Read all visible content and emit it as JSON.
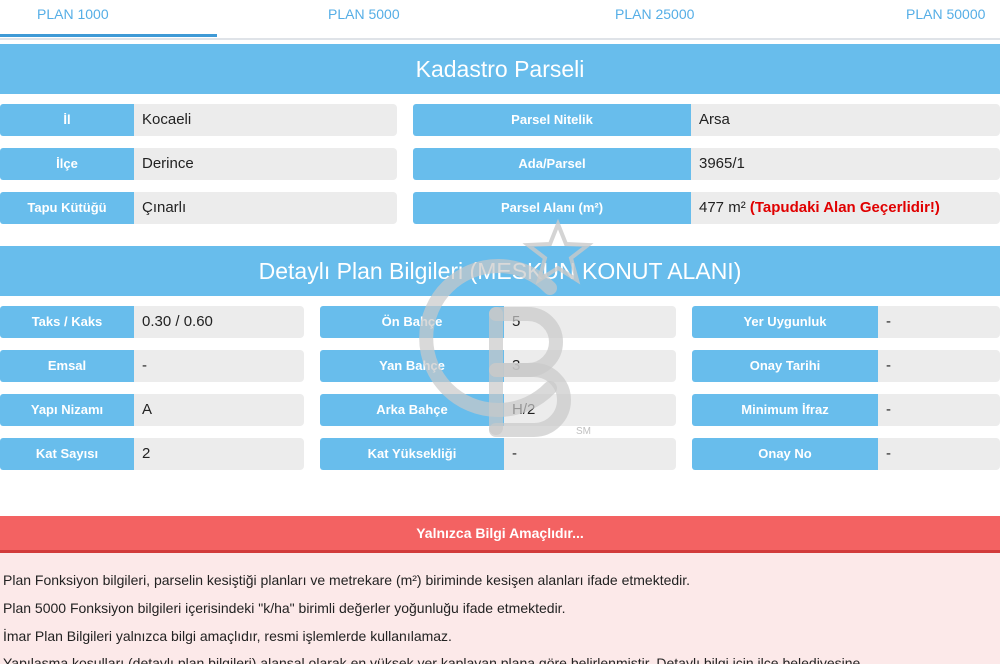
{
  "tabs": [
    {
      "label": "PLAN 1000",
      "active": true
    },
    {
      "label": "PLAN 5000",
      "active": false
    },
    {
      "label": "PLAN 25000",
      "active": false
    },
    {
      "label": "PLAN 50000",
      "active": false
    }
  ],
  "kadastro": {
    "title": "Kadastro Parseli",
    "left": [
      {
        "label": "İl",
        "value": "Kocaeli"
      },
      {
        "label": "İlçe",
        "value": "Derince"
      },
      {
        "label": "Tapu Kütüğü",
        "value": "Çınarlı"
      }
    ],
    "right": [
      {
        "label": "Parsel Nitelik",
        "value": "Arsa"
      },
      {
        "label": "Ada/Parsel",
        "value": "3965/1"
      },
      {
        "label": "Parsel Alanı (m²)",
        "value": "477 m²",
        "note": "(Tapudaki Alan Geçerlidir!)"
      }
    ]
  },
  "plan": {
    "title": "Detaylı Plan Bilgileri (MESKUN KONUT ALANI)",
    "col1": [
      {
        "label": "Taks / Kaks",
        "value": "0.30 / 0.60"
      },
      {
        "label": "Emsal",
        "value": "-"
      },
      {
        "label": "Yapı Nizamı",
        "value": "A"
      },
      {
        "label": "Kat Sayısı",
        "value": "2"
      }
    ],
    "col2": [
      {
        "label": "Ön Bahçe",
        "value": "5"
      },
      {
        "label": "Yan Bahçe",
        "value": "3"
      },
      {
        "label": "Arka Bahçe",
        "value": "H/2"
      },
      {
        "label": "Kat Yüksekliği",
        "value": "-"
      }
    ],
    "col3": [
      {
        "label": "Yer Uygunluk",
        "value": "-"
      },
      {
        "label": "Onay Tarihi",
        "value": "-"
      },
      {
        "label": "Minimum İfraz",
        "value": "-"
      },
      {
        "label": "Onay No",
        "value": "-"
      }
    ]
  },
  "warning": {
    "title": "Yalnızca Bilgi Amaçlıdır...",
    "lines": [
      "Plan Fonksiyon bilgileri, parselin kesiştiği planları ve metrekare (m²) biriminde kesişen alanları ifade etmektedir.",
      "Plan 5000 Fonksiyon bilgileri içerisindeki \"k/ha\" birimli değerler yoğunluğu ifade etmektedir.",
      "İmar Plan Bilgileri yalnızca bilgi amaçlıdır, resmi işlemlerde kullanılamaz.",
      "Yapılaşma koşulları (detaylı plan bilgileri) alansal olarak en yüksek yer kaplayan plana göre belirlenmiştir. Detaylı bilgi için ilçe belediyesine"
    ]
  },
  "watermark": {
    "text": "SM"
  },
  "colors": {
    "accent": "#68bdec",
    "tab_text": "#55aee6",
    "value_bg": "#ececec",
    "warning": "#f36262",
    "note_red": "#e00000"
  }
}
